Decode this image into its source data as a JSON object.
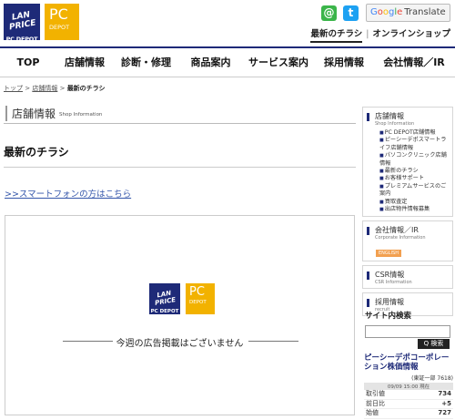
{
  "header": {
    "logo_main_top": "LAN PRICE",
    "logo_main_bottom": "PC DEPOT",
    "logo_sub_top": "PC",
    "logo_sub_bottom": "DEPOT",
    "mail_icon": "@",
    "twitter_icon": "t",
    "translate_g": "G",
    "translate_o1": "o",
    "translate_o2": "o",
    "translate_g2": "g",
    "translate_l": "l",
    "translate_e": "e",
    "translate_label": "Translate",
    "links": [
      "最新のチラシ",
      "オンラインショップ"
    ],
    "colors": {
      "navy": "#1e2a78",
      "yellow": "#f2b200"
    }
  },
  "nav": [
    "TOP",
    "店舗情報",
    "診断・修理",
    "商品案内",
    "サービス案内",
    "採用情報",
    "会社情報／IR"
  ],
  "breadcrumb": {
    "home": "トップ",
    "sep1": ">",
    "store": "店舗情報",
    "sep2": ">",
    "current": "最新のチラシ"
  },
  "section": {
    "title": "店舗情報",
    "subtitle": "Shop Information"
  },
  "main": {
    "page_title": "最新のチラシ",
    "smartphone_link": ">>スマートフォンの方はこちら",
    "flyer_logo_top": "LAN PRICE",
    "flyer_logo_bottom": "PC DEPOT",
    "flyer_logo2_top": "PC",
    "flyer_logo2_bottom": "DEPOT",
    "no_ad_message": "今週の広告掲載はございません"
  },
  "sidebar": {
    "store": {
      "title": "店舗情報",
      "subtitle": "Shop Information",
      "items": [
        "PC DEPOT店舗情報",
        "ピーシーデポスマートライフ店舗情報",
        "パソコンクリニック店舗情報",
        "最新のチラシ",
        "お客様サポート",
        "プレミアムサービスのご案内",
        "買取査定",
        "出店物件情報募集"
      ]
    },
    "ir": {
      "title": "会社情報／IR",
      "subtitle": "Corporate Information",
      "badge": "ENGLISH"
    },
    "csr": {
      "title": "CSR情報",
      "subtitle": "CSR Information"
    },
    "recruit": {
      "title": "採用情報",
      "subtitle": "recruit"
    }
  },
  "search": {
    "label": "サイト内検索",
    "value": "",
    "button": "Q 検索"
  },
  "stock": {
    "title": "ピーシーデポコーポレーション株価情報",
    "code": "(東証一部 7618)",
    "date": "09/09 15:00 現在",
    "rows": [
      {
        "label": "取引値",
        "value": "734"
      },
      {
        "label": "前日比",
        "value": "+5"
      },
      {
        "label": "始値",
        "value": "727"
      }
    ]
  }
}
